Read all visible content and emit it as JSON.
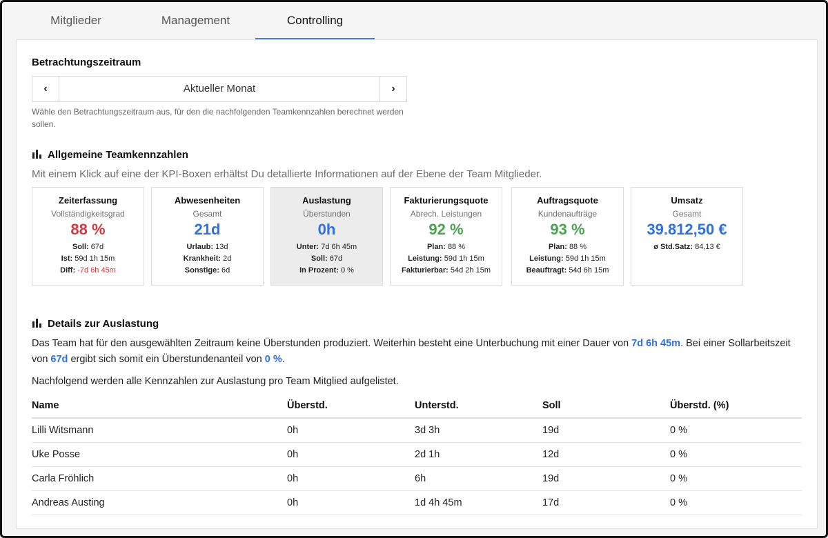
{
  "tabs": [
    {
      "label": "Mitglieder",
      "active": false
    },
    {
      "label": "Management",
      "active": false
    },
    {
      "label": "Controlling",
      "active": true
    }
  ],
  "period": {
    "heading": "Betrachtungszeitraum",
    "prev_icon": "‹",
    "next_icon": "›",
    "value": "Aktueller Monat",
    "hint": "Wähle den Betrachtungszeitraum aus, für den die nachfolgenden Teamkennzahlen berechnet werden sollen."
  },
  "general": {
    "heading": "Allgemeine Teamkennzahlen",
    "subtitle": "Mit einem Klick auf eine der KPI-Boxen erhältst Du detallierte Informationen auf der Ebene der Team Mitglieder."
  },
  "kpis": [
    {
      "title": "Zeiterfassung",
      "sub": "Vollständigkeitsgrad",
      "value": "88 %",
      "color": "red",
      "details": [
        {
          "k": "Soll:",
          "v": "67d"
        },
        {
          "k": "Ist:",
          "v": "59d 1h 15m"
        },
        {
          "k": "Diff:",
          "v": "-7d 6h 45m",
          "red": true
        }
      ]
    },
    {
      "title": "Abwesenheiten",
      "sub": "Gesamt",
      "value": "21d",
      "color": "blue",
      "details": [
        {
          "k": "Urlaub:",
          "v": "13d"
        },
        {
          "k": "Krankheit:",
          "v": "2d"
        },
        {
          "k": "Sonstige:",
          "v": "6d"
        }
      ]
    },
    {
      "title": "Auslastung",
      "sub": "Überstunden",
      "value": "0h",
      "color": "blue",
      "selected": true,
      "details": [
        {
          "k": "Unter:",
          "v": "7d 6h 45m"
        },
        {
          "k": "Soll:",
          "v": "67d"
        },
        {
          "k": "In Prozent:",
          "v": "0 %"
        }
      ]
    },
    {
      "title": "Fakturierungsquote",
      "sub": "Abrech. Leistungen",
      "value": "92 %",
      "color": "green",
      "details": [
        {
          "k": "Plan:",
          "v": "88 %"
        },
        {
          "k": "Leistung:",
          "v": "59d 1h 15m"
        },
        {
          "k": "Fakturierbar:",
          "v": "54d 2h 15m"
        }
      ]
    },
    {
      "title": "Auftragsquote",
      "sub": "Kundenaufträge",
      "value": "93 %",
      "color": "green",
      "details": [
        {
          "k": "Plan:",
          "v": "88 %"
        },
        {
          "k": "Leistung:",
          "v": "59d 1h 15m"
        },
        {
          "k": "Beauftragt:",
          "v": "54d 6h 15m"
        }
      ]
    },
    {
      "title": "Umsatz",
      "sub": "Gesamt",
      "value": "39.812,50 €",
      "color": "blue",
      "details": [
        {
          "k": "ø Std.Satz:",
          "v": "84,13 €"
        }
      ]
    }
  ],
  "details": {
    "heading": "Details zur Auslastung",
    "para1": {
      "p1": "Das Team hat für den ausgewählten Zeitraum keine Überstunden produziert. Weiterhin besteht eine Unterbuchung mit einer Dauer von ",
      "h1": "7d 6h 45m",
      "p2": ". Bei einer Sollarbeitszeit von ",
      "h2": "67d",
      "p3": " ergibt sich somit ein Überstundenanteil von ",
      "h3": "0 %",
      "p4": "."
    },
    "para2": "Nachfolgend werden alle Kennzahlen zur Auslastung pro Team Mitglied aufgelistet."
  },
  "table": {
    "headers": [
      "Name",
      "Überstd.",
      "Unterstd.",
      "Soll",
      "Überstd. (%)"
    ],
    "rows": [
      [
        "Lilli Witsmann",
        "0h",
        "3d 3h",
        "19d",
        "0 %"
      ],
      [
        "Uke Posse",
        "0h",
        "2d 1h",
        "12d",
        "0 %"
      ],
      [
        "Carla Fröhlich",
        "0h",
        "6h",
        "19d",
        "0 %"
      ],
      [
        "Andreas Austing",
        "0h",
        "1d 4h 45m",
        "17d",
        "0 %"
      ]
    ]
  },
  "colors": {
    "accent": "#4a7fd8",
    "red": "#cf3b40",
    "blue": "#2f6fde",
    "green": "#4aa34f"
  }
}
